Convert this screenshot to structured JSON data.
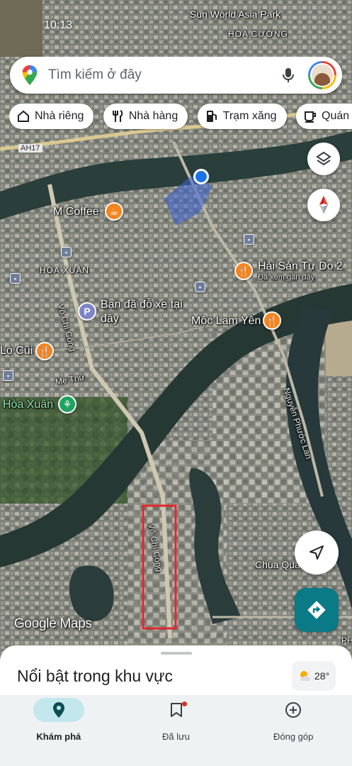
{
  "status_bar": {
    "time": "10:13"
  },
  "search": {
    "placeholder": "Tìm kiếm ở đây"
  },
  "chips": [
    {
      "label": "Nhà riêng",
      "icon": "home-icon"
    },
    {
      "label": "Nhà hàng",
      "icon": "restaurant-icon"
    },
    {
      "label": "Trạm xăng",
      "icon": "gas-station-icon"
    },
    {
      "label": "Quán cà",
      "icon": "coffee-icon"
    }
  ],
  "map": {
    "places": {
      "sun_world": "Sun World Asia Park",
      "hoa_cuong": "HÒA CƯỜNG",
      "m_coffee": "M Coffee",
      "hoa_xuan_district": "HÒA XUÂN",
      "parked": "Bạn đã đỗ xe tại đây",
      "hai_san": "Hải Sản Tự Do 2",
      "hai_san_note": "Đã xem gần đây",
      "moc_lam_yen": "Mộc Lam Yên",
      "lo_cui": "Lò Cũi",
      "hoa_xuan_park": "Hòa Xuân",
      "chua_quan_am": "Chùa Quán Âm",
      "ph": "PH"
    },
    "roads": {
      "ah17": "AH17",
      "vo_chi_cong_1": "Võ Chí Công",
      "vo_chi_cong_2": "Võ Chí Công",
      "me_thu": "Mẹ Thứ",
      "nguyen_phuoc_lan": "Nguyễn Phước Lan"
    },
    "highlight_color": "#e0282e",
    "location_dot_color": "#1a73e8"
  },
  "attribution": {
    "google": "Google",
    "maps": "Maps"
  },
  "sheet": {
    "title": "Nổi bật trong khu vực",
    "weather_temp": "28°",
    "weather_icon": "partly-cloudy-icon"
  },
  "nav": {
    "explore": "Khám phá",
    "saved": "Đã lưu",
    "contribute": "Đóng góp"
  },
  "colors": {
    "accent_teal": "#0a7a86",
    "nav_active_bg": "#c2e7ec",
    "orange_pin": "#f5841f"
  }
}
